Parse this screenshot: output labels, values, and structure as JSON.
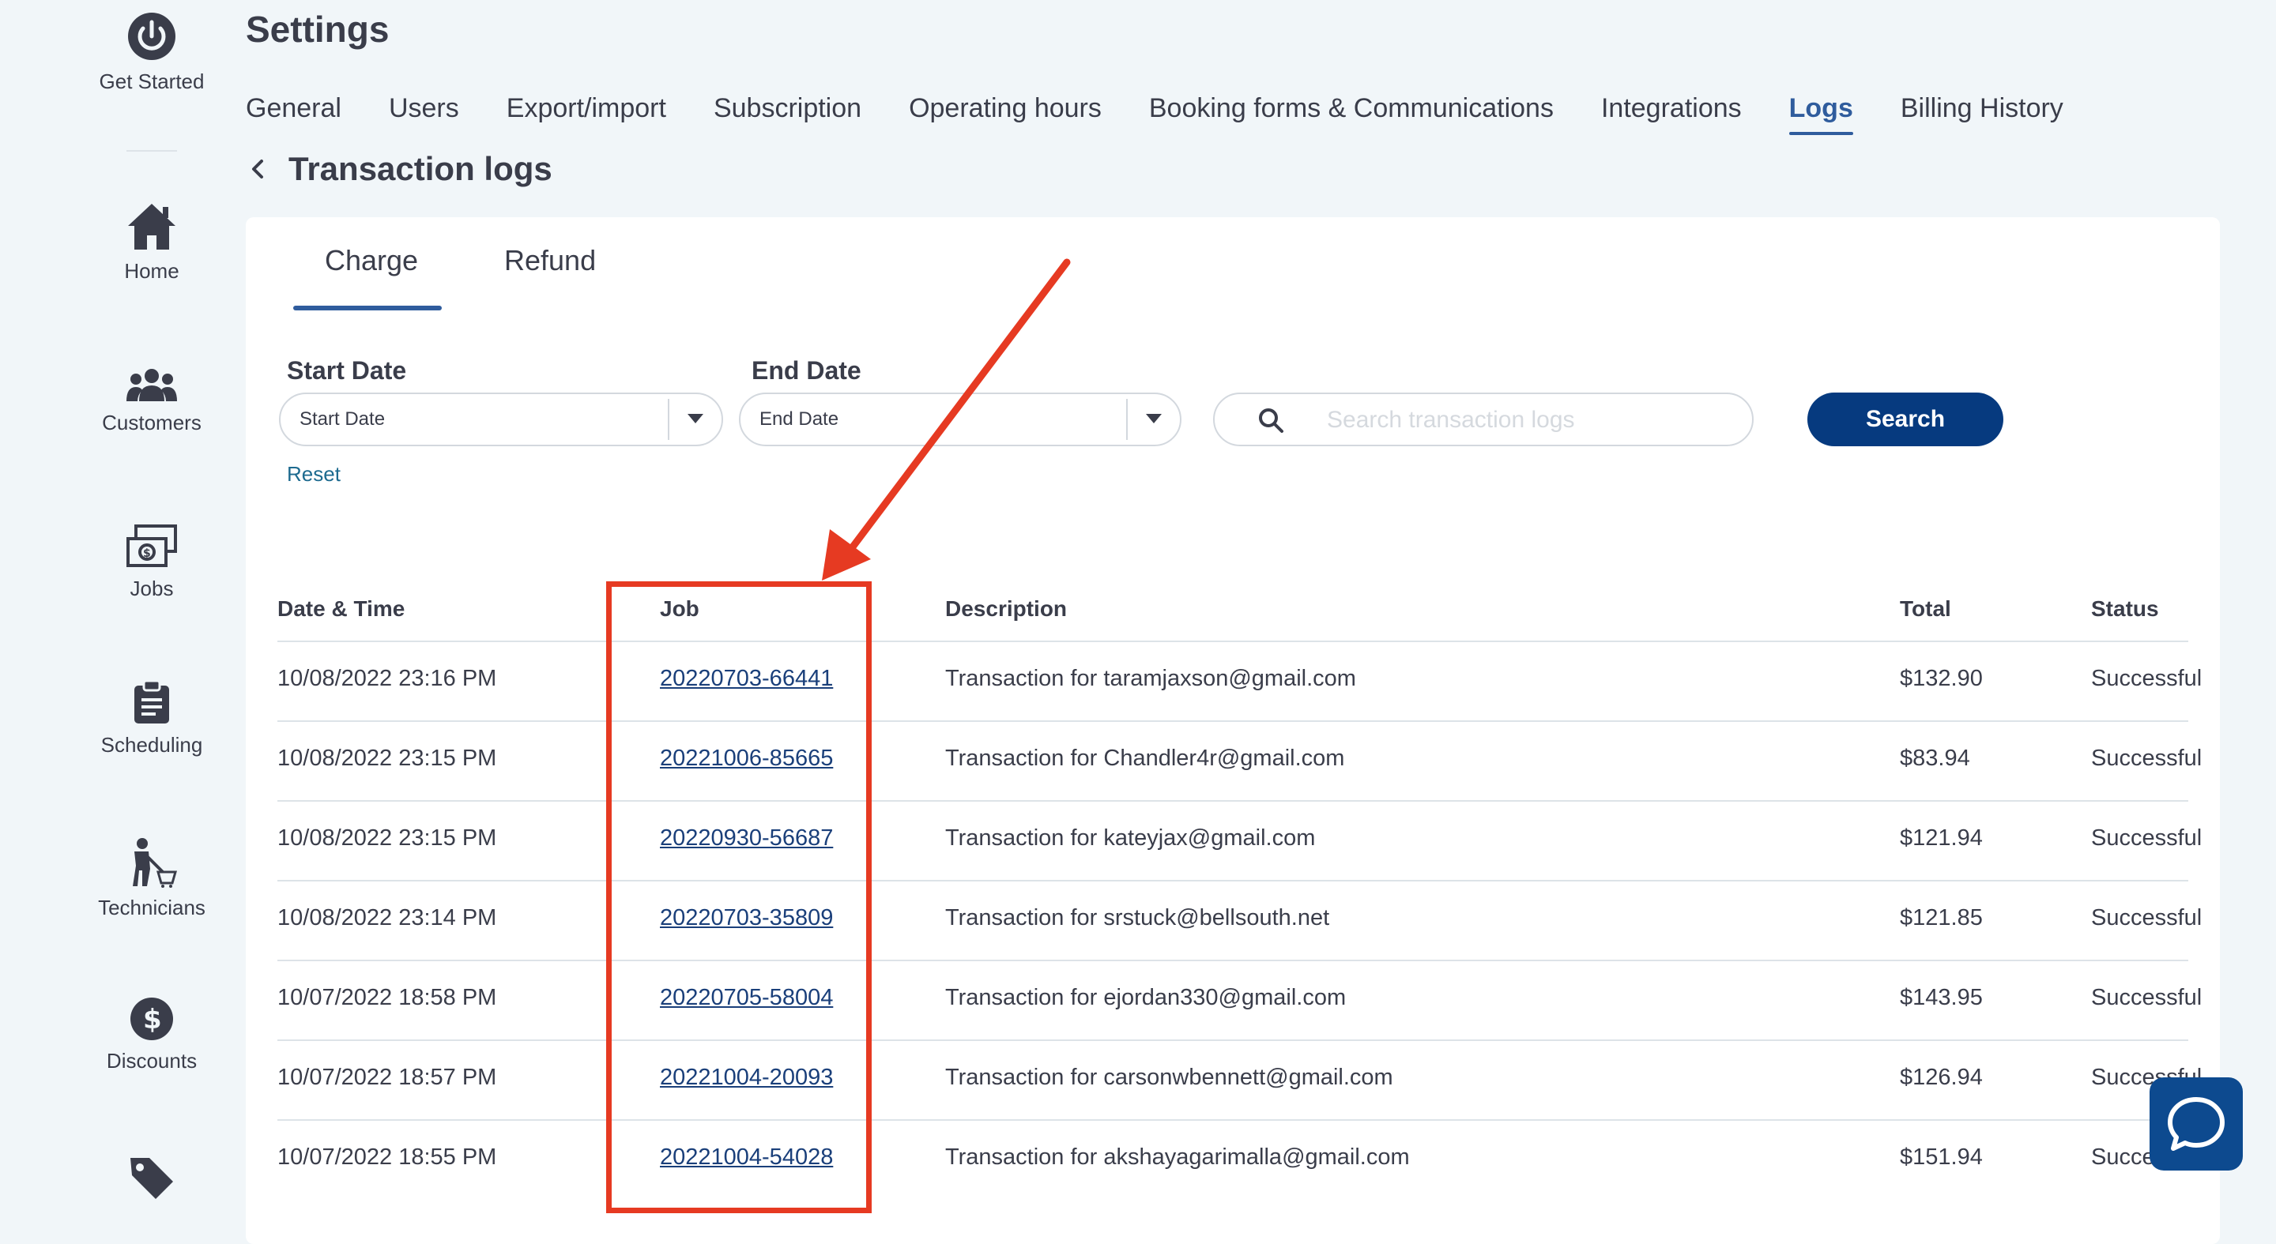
{
  "sidebar": {
    "items": [
      {
        "label": "Get Started",
        "icon": "power-icon"
      },
      {
        "label": "Home",
        "icon": "home-icon"
      },
      {
        "label": "Customers",
        "icon": "customers-icon"
      },
      {
        "label": "Jobs",
        "icon": "jobs-icon"
      },
      {
        "label": "Scheduling",
        "icon": "clipboard-icon"
      },
      {
        "label": "Technicians",
        "icon": "technician-icon"
      },
      {
        "label": "Discounts",
        "icon": "dollar-icon"
      },
      {
        "label": "",
        "icon": "tag-icon"
      }
    ]
  },
  "header": {
    "title": "Settings",
    "tabs": [
      {
        "label": "General"
      },
      {
        "label": "Users"
      },
      {
        "label": "Export/import"
      },
      {
        "label": "Subscription"
      },
      {
        "label": "Operating hours"
      },
      {
        "label": "Booking forms & Communications"
      },
      {
        "label": "Integrations"
      },
      {
        "label": "Logs",
        "active": true
      },
      {
        "label": "Billing History"
      }
    ]
  },
  "subpage": {
    "title": "Transaction logs"
  },
  "subtabs": {
    "charge": "Charge",
    "refund": "Refund",
    "active": "Charge"
  },
  "filters": {
    "start_label": "Start Date",
    "start_placeholder": "Start Date",
    "end_label": "End Date",
    "end_placeholder": "End Date",
    "search_placeholder": "Search transaction logs",
    "search_button": "Search",
    "reset": "Reset"
  },
  "table": {
    "headers": {
      "datetime": "Date & Time",
      "job": "Job",
      "description": "Description",
      "total": "Total",
      "status": "Status"
    },
    "rows": [
      {
        "datetime": "10/08/2022 23:16 PM",
        "job": "20220703-66441",
        "description": "Transaction for taramjaxson@gmail.com",
        "total": "$132.90",
        "status": "Successful"
      },
      {
        "datetime": "10/08/2022 23:15 PM",
        "job": "20221006-85665",
        "description": "Transaction for Chandler4r@gmail.com",
        "total": "$83.94",
        "status": "Successful"
      },
      {
        "datetime": "10/08/2022 23:15 PM",
        "job": "20220930-56687",
        "description": "Transaction for kateyjax@gmail.com",
        "total": "$121.94",
        "status": "Successful"
      },
      {
        "datetime": "10/08/2022 23:14 PM",
        "job": "20220703-35809",
        "description": "Transaction for srstuck@bellsouth.net",
        "total": "$121.85",
        "status": "Successful"
      },
      {
        "datetime": "10/07/2022 18:58 PM",
        "job": "20220705-58004",
        "description": "Transaction for ejordan330@gmail.com",
        "total": "$143.95",
        "status": "Successful"
      },
      {
        "datetime": "10/07/2022 18:57 PM",
        "job": "20221004-20093",
        "description": "Transaction for carsonwbennett@gmail.com",
        "total": "$126.94",
        "status": "Successful"
      },
      {
        "datetime": "10/07/2022 18:55 PM",
        "job": "20221004-54028",
        "description": "Transaction for akshayagarimalla@gmail.com",
        "total": "$151.94",
        "status": "Successful"
      }
    ]
  },
  "colors": {
    "accent": "#2f5c9d",
    "primary_button": "#063a7f",
    "annotation": "#e63a22",
    "link": "#1a3f7a"
  }
}
